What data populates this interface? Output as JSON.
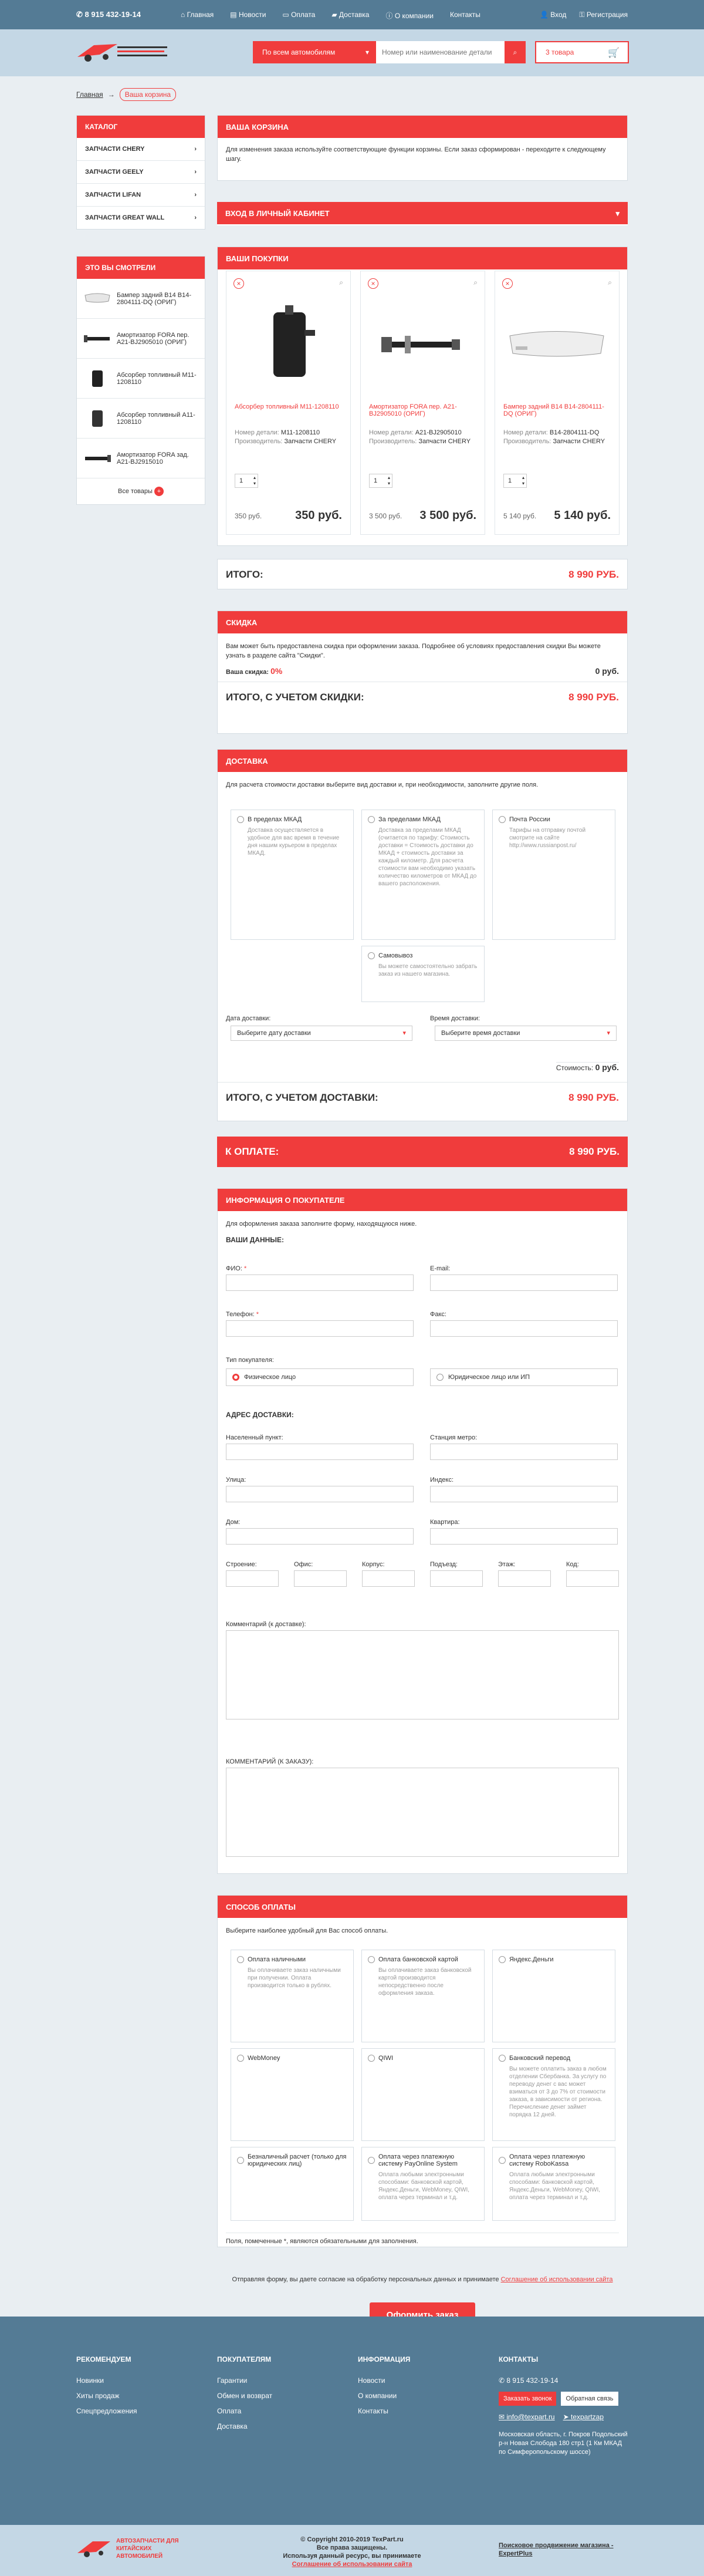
{
  "topbar": {
    "phone": "8 915 432-19-14",
    "nav": [
      "Главная",
      "Новости",
      "Оплата",
      "Доставка",
      "О компании",
      "Контакты"
    ],
    "login": "Вход",
    "register": "Регистрация"
  },
  "header": {
    "search_category": "По всем автомобилям",
    "search_placeholder": "Номер или наименование детали",
    "cart": "3 товара"
  },
  "breadcrumb": {
    "home": "Главная",
    "current": "Ваша корзина"
  },
  "catalog": {
    "title": "КАТАЛОГ",
    "items": [
      "ЗАПЧАСТИ CHERY",
      "ЗАПЧАСТИ GEELY",
      "ЗАПЧАСТИ LIFAN",
      "ЗАПЧАСТИ GREAT WALL"
    ]
  },
  "viewed": {
    "title": "ЭТО ВЫ СМОТРЕЛИ",
    "items": [
      "Бампер задний B14 B14-2804111-DQ (ОРИГ)",
      "Амортизатор FORA пер. A21-BJ2905010 (ОРИГ)",
      "Абсорбер топливный M11-1208110",
      "Абсорбер топливный A11-1208110",
      "Амортизатор FORA зад. A21-BJ2915010"
    ],
    "all": "Все товары"
  },
  "cart": {
    "title": "ВАША КОРЗИНА",
    "text": "Для изменения заказа используйте соответствующие функции корзины. Если заказ сформирован - переходите к следующему шагу."
  },
  "cabinet": {
    "title": "ВХОД В ЛИЧНЫЙ КАБИНЕТ"
  },
  "purchases": {
    "title": "ВАШИ ПОКУПКИ",
    "products": [
      {
        "name": "Абсорбер топливный M11-1208110",
        "num_label": "Номер детали:",
        "num": "M11-1208110",
        "maker_label": "Производитель:",
        "maker": "Запчасти CHERY",
        "qty": "1",
        "old": "350 руб.",
        "price": "350 руб."
      },
      {
        "name": "Амортизатор FORA пер. A21-BJ2905010 (ОРИГ)",
        "num_label": "Номер детали:",
        "num": "A21-BJ2905010",
        "maker_label": "Производитель:",
        "maker": "Запчасти CHERY",
        "qty": "1",
        "old": "3 500 руб.",
        "price": "3 500 руб."
      },
      {
        "name": "Бампер задний B14 B14-2804111-DQ (ОРИГ)",
        "num_label": "Номер детали:",
        "num": "B14-2804111-DQ",
        "maker_label": "Производитель:",
        "maker": "Запчасти CHERY",
        "qty": "1",
        "old": "5 140 руб.",
        "price": "5 140 руб."
      }
    ]
  },
  "total": {
    "label": "ИТОГО:",
    "value": "8 990 РУБ."
  },
  "discount": {
    "title": "СКИДКА",
    "text": "Вам может быть предоставлена скидка при оформлении заказа. Подробнее об условиях предоставления скидки Вы можете узнать в разделе сайта \"Скидки\".",
    "your_label": "Ваша скидка:",
    "your_value": "0%",
    "amount": "0 руб.",
    "total_label": "ИТОГО, С УЧЕТОМ СКИДКИ:",
    "total_value": "8 990 РУБ."
  },
  "delivery": {
    "title": "ДОСТАВКА",
    "intro": "Для расчета стоимости доставки выберите вид доставки и, при необходимости, заполните другие поля.",
    "options": [
      {
        "t": "В пределах МКАД",
        "d": "Доставка осуществляется в удобное для вас время в течение дня нашим курьером в пределах МКАД."
      },
      {
        "t": "За пределами МКАД",
        "d": "Доставка за пределами МКАД (считается по тарифу: Стоимость доставки = Стоимость доставки до МКАД + стоимость доставки за каждый километр. Для расчета стоимости вам необходимо указать количество километров от МКАД до вашего расположения."
      },
      {
        "t": "Почта России",
        "d": "Тарифы на отправку почтой смотрите на сайте http://www.russianpost.ru/"
      },
      {
        "t": "Самовывоз",
        "d": "Вы можете самостоятельно забрать заказ из нашего магазина."
      }
    ],
    "date_label": "Дата доставки:",
    "date_ph": "Выберите дату доставки",
    "time_label": "Время доставки:",
    "time_ph": "Выберите время доставки",
    "cost_label": "Стоимость:",
    "cost": "0 руб.",
    "total_label": "ИТОГО, С УЧЕТОМ ДОСТАВКИ:",
    "total_value": "8 990 РУБ."
  },
  "topay": {
    "label": "К ОПЛАТЕ:",
    "value": "8 990 РУБ."
  },
  "buyer": {
    "title": "ИНФОРМАЦИЯ О ПОКУПАТЕЛЕ",
    "intro": "Для оформления заказа заполните форму, находящуюся ниже.",
    "data_title": "ВАШИ ДАННЫЕ:",
    "fio": "ФИО:",
    "email": "E-mail:",
    "phone": "Телефон:",
    "fax": "Факс:",
    "type_label": "Тип покупателя:",
    "type1": "Физическое лицо",
    "type2": "Юридическое лицо или ИП",
    "addr_title": "АДРЕС ДОСТАВКИ:",
    "city": "Населенный пункт:",
    "metro": "Станция метро:",
    "street": "Улица:",
    "index": "Индекс:",
    "house": "Дом:",
    "flat": "Квартира:",
    "building": "Строение:",
    "office": "Офис:",
    "korpus": "Корпус:",
    "entrance": "Подъезд:",
    "floor": "Этаж:",
    "code": "Код:",
    "comment_delivery": "Комментарий (к доставке):",
    "comment_order": "КОММЕНТАРИЙ (К ЗАКАЗУ):"
  },
  "payment": {
    "title": "СПОСОБ ОПЛАТЫ",
    "intro": "Выберите наиболее удобный для Вас способ оплаты.",
    "options": [
      {
        "t": "Оплата наличными",
        "d": "Вы оплачиваете заказ наличными при получении. Оплата производится только в рублях."
      },
      {
        "t": "Оплата банковской картой",
        "d": "Вы оплачиваете заказ банковской картой производится непосредственно после оформления заказа."
      },
      {
        "t": "Яндекс.Деньги",
        "d": ""
      },
      {
        "t": "WebMoney",
        "d": ""
      },
      {
        "t": "QIWI",
        "d": ""
      },
      {
        "t": "Банковский перевод",
        "d": "Вы можете оплатить заказ в любом отделении Сбербанка. За услугу по переводу денег с вас может взиматься от 3 до 7% от стоимости заказа, в зависимости от региона. Перечисление денег займет порядка 12 дней."
      },
      {
        "t": "Безналичный расчет (только для юридических лиц)",
        "d": ""
      },
      {
        "t": "Оплата через платежную систему PayOnline System",
        "d": "Оплата любыми электронными способами: банковской картой, Яндекс.Деньги, WebMoney, QIWI, оплата через терминал и т.д."
      },
      {
        "t": "Оплата через платежную систему RoboKassa",
        "d": "Оплата любыми электронными способами: банковской картой, Яндекс.Деньги, WebMoney, QIWI, оплата через терминал и т.д."
      }
    ],
    "note": "Поля, помеченные *, являются обязательными для заполнения."
  },
  "consent": {
    "text": "Отправляя форму, вы даете согласие на обработку персональных данных и принимаете",
    "link": "Соглашение об использовании сайта"
  },
  "submit": "Оформить заказ",
  "footer": {
    "col1": {
      "h": "РЕКОМЕНДУЕМ",
      "items": [
        "Новинки",
        "Хиты продаж",
        "Спецпредложения"
      ]
    },
    "col2": {
      "h": "ПОКУПАТЕЛЯМ",
      "items": [
        "Гарантии",
        "Обмен и возврат",
        "Оплата",
        "Доставка"
      ]
    },
    "col3": {
      "h": "ИНФОРМАЦИЯ",
      "items": [
        "Новости",
        "О компании",
        "Контакты"
      ]
    },
    "col4": {
      "h": "КОНТАКТЫ",
      "phone": "8 915 432-19-14",
      "call": "Заказать звонок",
      "feedback": "Обратная связь",
      "email": "info@texpart.ru",
      "tg": "texpartzap",
      "addr": "Московская область, г. Покров Подольский р-н Новая Слобода 180 стр1 (1 Км МКАД по Симферопольскому шоссе)"
    },
    "copy": "© Copyright 2010-2019 TexPart.ru",
    "rights": "Все права защищены.",
    "agree": "Используя данный ресурс, вы принимаете",
    "agree_link": "Соглашение об использовании сайта",
    "promo": "Поисковое продвижение магазина - ExpertPlus",
    "logo_text": "АВТОЗАПЧАСТИ ДЛЯ КИТАЙСКИХ АВТОМОБИЛЕЙ"
  },
  "colors": {
    "accent": "#f03c3c",
    "topbar": "#547b95",
    "header": "#c4d7e5"
  }
}
